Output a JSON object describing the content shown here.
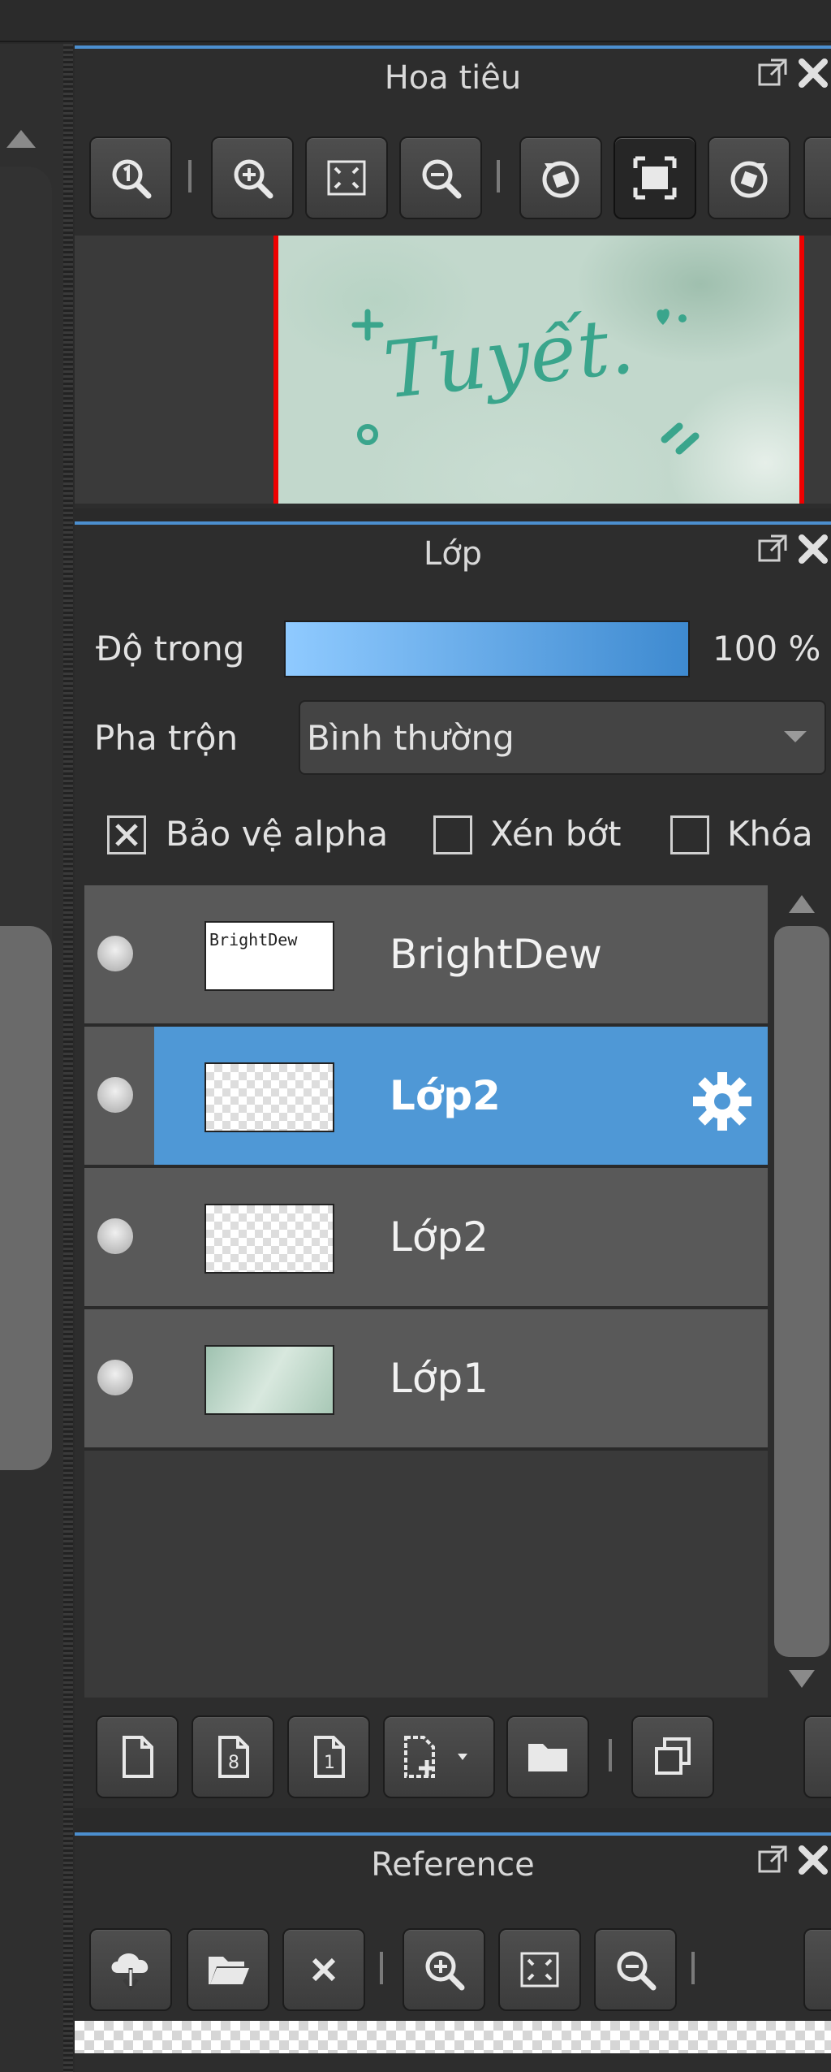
{
  "navigator": {
    "title": "Hoa tiêu",
    "preview_text": "Tuyết."
  },
  "layers": {
    "title": "Lớp",
    "opacity_label": "Độ trong",
    "opacity_value": "100 %",
    "opacity_fraction": 1.0,
    "blend_label": "Pha trộn",
    "blend_value": "Bình thường",
    "protect_alpha_label": "Bảo vệ alpha",
    "protect_alpha_checked": true,
    "clipping_label": "Xén bớt",
    "clipping_checked": false,
    "lock_label": "Khóa",
    "lock_checked": false,
    "items": [
      {
        "name": "BrightDew",
        "selected": false,
        "thumb_text": "BrightDew"
      },
      {
        "name": "Lớp2",
        "selected": true,
        "thumb_text": ""
      },
      {
        "name": "Lớp2",
        "selected": false,
        "thumb_text": ""
      },
      {
        "name": "Lớp1",
        "selected": false,
        "thumb_text": ""
      }
    ]
  },
  "reference": {
    "title": "Reference"
  },
  "colors": {
    "accent": "#4c8fcf",
    "selection": "#4f98d6",
    "panel_bg": "#2d2d2d",
    "row_bg": "#595959",
    "nav_frame": "#ee0000"
  }
}
